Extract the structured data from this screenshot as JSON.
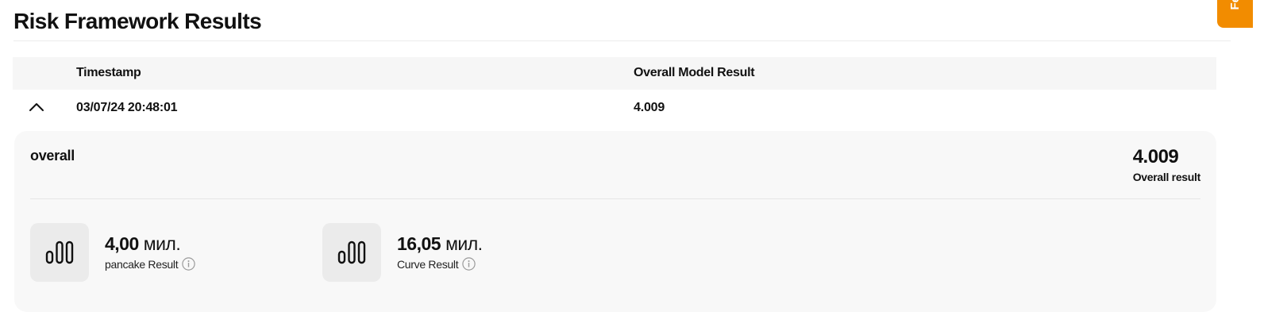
{
  "page": {
    "title": "Risk Framework Results"
  },
  "feedback_tab": {
    "label": "Fe"
  },
  "table": {
    "columns": {
      "timestamp": "Timestamp",
      "overall": "Overall Model Result"
    },
    "rows": [
      {
        "timestamp": "03/07/24 20:48:01",
        "overall": "4.009",
        "expanded": true
      }
    ]
  },
  "detail": {
    "name": "overall",
    "overall_value": "4.009",
    "overall_label": "Overall result",
    "metrics": [
      {
        "value": "4,00",
        "unit": "мил.",
        "label": "pancake Result",
        "icon": "bar-chart-icon"
      },
      {
        "value": "16,05",
        "unit": "мил.",
        "label": "Curve Result",
        "icon": "bar-chart-icon"
      }
    ]
  },
  "colors": {
    "accent": "#f28c00",
    "panel_bg": "#f8f8f8",
    "header_bg": "#f6f6f6"
  }
}
